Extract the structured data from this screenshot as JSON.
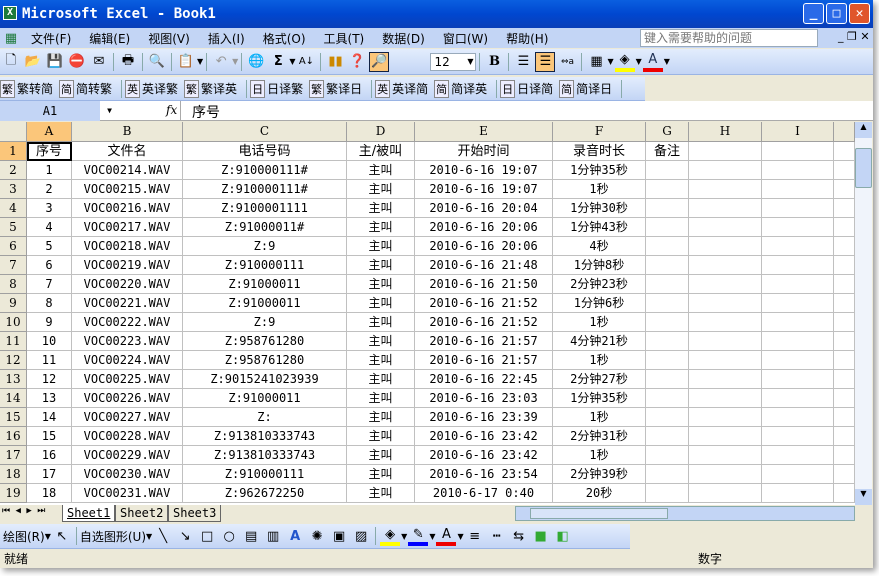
{
  "window": {
    "title": "Microsoft Excel - Book1"
  },
  "menu": [
    "文件(F)",
    "编辑(E)",
    "视图(V)",
    "插入(I)",
    "格式(O)",
    "工具(T)",
    "数据(D)",
    "窗口(W)",
    "帮助(H)"
  ],
  "help_placeholder": "键入需要帮助的问题",
  "toolbar": {
    "font_size": "12",
    "bold": "B"
  },
  "translate_toolbar": [
    {
      "icon": "繁",
      "label": "繁转简"
    },
    {
      "icon": "简",
      "label": "简转繁"
    },
    {
      "icon": "英",
      "label": "英译繁"
    },
    {
      "icon": "繁",
      "label": "繁译英"
    },
    {
      "icon": "日",
      "label": "日译繁"
    },
    {
      "icon": "繁",
      "label": "繁译日"
    },
    {
      "icon": "英",
      "label": "英译简"
    },
    {
      "icon": "简",
      "label": "简译英"
    },
    {
      "icon": "日",
      "label": "日译简"
    },
    {
      "icon": "简",
      "label": "简译日"
    }
  ],
  "formula_bar": {
    "name_box": "A1",
    "fx": "fx",
    "value": "序号"
  },
  "columns": [
    "A",
    "B",
    "C",
    "D",
    "E",
    "F",
    "G",
    "H",
    "I"
  ],
  "headers": [
    "序号",
    "文件名",
    "电话号码",
    "主/被叫",
    "开始时间",
    "录音时长",
    "备注"
  ],
  "rows": [
    [
      "1",
      "VOC00214.WAV",
      "Z:910000111#",
      "主叫",
      "2010-6-16 19:07",
      "1分钟35秒"
    ],
    [
      "2",
      "VOC00215.WAV",
      "Z:910000111#",
      "主叫",
      "2010-6-16 19:07",
      "1秒"
    ],
    [
      "3",
      "VOC00216.WAV",
      "Z:9100001111",
      "主叫",
      "2010-6-16 20:04",
      "1分钟30秒"
    ],
    [
      "4",
      "VOC00217.WAV",
      "Z:91000011#",
      "主叫",
      "2010-6-16 20:06",
      "1分钟43秒"
    ],
    [
      "5",
      "VOC00218.WAV",
      "Z:9",
      "主叫",
      "2010-6-16 20:06",
      "4秒"
    ],
    [
      "6",
      "VOC00219.WAV",
      "Z:910000111",
      "主叫",
      "2010-6-16 21:48",
      "1分钟8秒"
    ],
    [
      "7",
      "VOC00220.WAV",
      "Z:91000011",
      "主叫",
      "2010-6-16 21:50",
      "2分钟23秒"
    ],
    [
      "8",
      "VOC00221.WAV",
      "Z:91000011",
      "主叫",
      "2010-6-16 21:52",
      "1分钟6秒"
    ],
    [
      "9",
      "VOC00222.WAV",
      "Z:9",
      "主叫",
      "2010-6-16 21:52",
      "1秒"
    ],
    [
      "10",
      "VOC00223.WAV",
      "Z:958761280",
      "主叫",
      "2010-6-16 21:57",
      "4分钟21秒"
    ],
    [
      "11",
      "VOC00224.WAV",
      "Z:958761280",
      "主叫",
      "2010-6-16 21:57",
      "1秒"
    ],
    [
      "12",
      "VOC00225.WAV",
      "Z:9015241023939",
      "主叫",
      "2010-6-16 22:45",
      "2分钟27秒"
    ],
    [
      "13",
      "VOC00226.WAV",
      "Z:91000011",
      "主叫",
      "2010-6-16 23:03",
      "1分钟35秒"
    ],
    [
      "14",
      "VOC00227.WAV",
      "Z:",
      "主叫",
      "2010-6-16 23:39",
      "1秒"
    ],
    [
      "15",
      "VOC00228.WAV",
      "Z:913810333743",
      "主叫",
      "2010-6-16 23:42",
      "2分钟31秒"
    ],
    [
      "16",
      "VOC00229.WAV",
      "Z:913810333743",
      "主叫",
      "2010-6-16 23:42",
      "1秒"
    ],
    [
      "17",
      "VOC00230.WAV",
      "Z:910000111",
      "主叫",
      "2010-6-16 23:54",
      "2分钟39秒"
    ],
    [
      "18",
      "VOC00231.WAV",
      "Z:962672250",
      "主叫",
      "2010-6-17 0:40",
      "20秒"
    ]
  ],
  "sheets": [
    "Sheet1",
    "Sheet2",
    "Sheet3"
  ],
  "drawing_toolbar": {
    "draw": "绘图(R)",
    "autoshapes": "自选图形(U)"
  },
  "status": {
    "left": "就绪",
    "num": "数字"
  }
}
